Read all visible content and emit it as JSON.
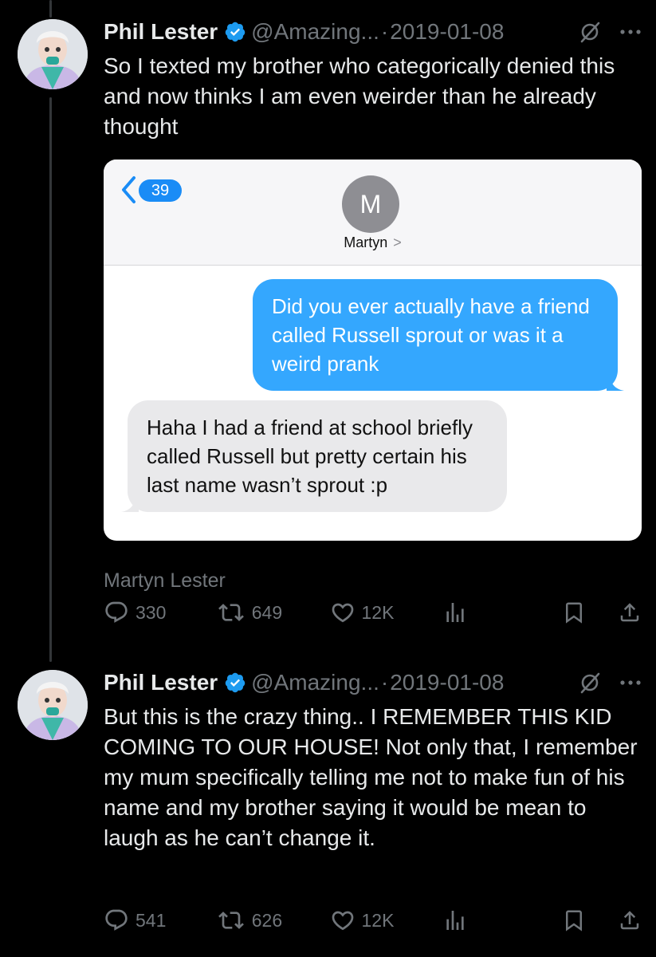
{
  "tweets": [
    {
      "author": "Phil Lester",
      "handle": "@Amazing...",
      "separator": "·",
      "date": "2019-01-08",
      "text": "So I texted my brother who categorically denied this and now thinks I am even weirder than he already thought",
      "media": {
        "back_count": "39",
        "contact_initial": "M",
        "contact_name": "Martyn",
        "contact_chevron": ">",
        "sent_message": "Did you ever actually have a friend called Russell sprout or was it a weird prank",
        "received_message": "Haha I had a friend at school briefly called Russell but pretty certain his last name wasn’t sprout :p"
      },
      "caption": "Martyn Lester",
      "stats": {
        "replies": "330",
        "retweets": "649",
        "likes": "12K"
      }
    },
    {
      "author": "Phil Lester",
      "handle": "@Amazing...",
      "separator": "·",
      "date": "2019-01-08",
      "text": "But this is the crazy thing.. I REMEMBER THIS KID COMING TO OUR HOUSE! Not only that, I remember my mum specifically telling me not to make fun of his name and my brother saying it would be mean to laugh as he can’t change it.",
      "stats": {
        "replies": "541",
        "retweets": "626",
        "likes": "12K"
      }
    }
  ],
  "colors": {
    "background": "#000000",
    "text_primary": "#e7e9ea",
    "text_secondary": "#71767b",
    "verified_blue": "#1d9bf0",
    "imessage_blue": "#34a7fe",
    "imessage_gray": "#e9e9eb"
  },
  "icons": [
    "verified-badge-icon",
    "grok-icon",
    "more-icon",
    "reply-icon",
    "retweet-icon",
    "like-icon",
    "views-icon",
    "bookmark-icon",
    "share-icon"
  ]
}
